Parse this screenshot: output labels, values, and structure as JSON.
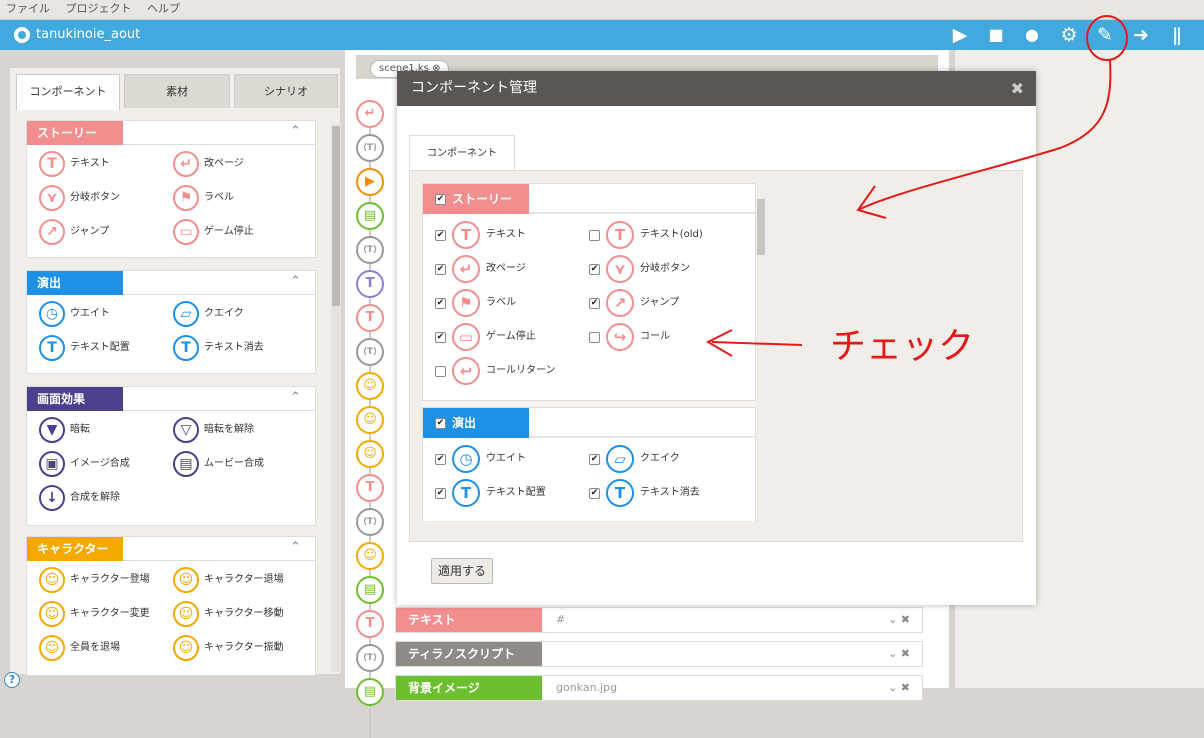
{
  "menu": [
    "ファイル",
    "プロジェクト",
    "ヘルプ"
  ],
  "app": {
    "title": "tanukinoie_aout"
  },
  "toolbar": {
    "play": "▶",
    "save": "■",
    "user": "●",
    "settings": "⚙",
    "tools": "✎",
    "export": "➜",
    "exit": "ǁ"
  },
  "left": {
    "tabs": [
      "コンポーネント",
      "素材",
      "シナリオ"
    ],
    "panels": [
      {
        "title": "ストーリー",
        "color": "#f28e8e",
        "items": [
          {
            "label": "テキスト",
            "glyph": "T"
          },
          {
            "label": "改ページ",
            "glyph": "↵"
          },
          {
            "label": "分岐ボタン",
            "glyph": "⋎"
          },
          {
            "label": "ラベル",
            "glyph": "⚑"
          },
          {
            "label": "ジャンプ",
            "glyph": "↗"
          },
          {
            "label": "ゲーム停止",
            "glyph": "▭"
          }
        ]
      },
      {
        "title": "演出",
        "color": "#1e90e6",
        "items": [
          {
            "label": "ウエイト",
            "glyph": "◷"
          },
          {
            "label": "クエイク",
            "glyph": "▱"
          },
          {
            "label": "テキスト配置",
            "glyph": "T"
          },
          {
            "label": "テキスト消去",
            "glyph": "T"
          }
        ]
      },
      {
        "title": "画面効果",
        "color": "#4c3f8c",
        "items": [
          {
            "label": "暗転",
            "glyph": "▼"
          },
          {
            "label": "暗転を解除",
            "glyph": "▽"
          },
          {
            "label": "イメージ合成",
            "glyph": "▣"
          },
          {
            "label": "ムービー合成",
            "glyph": "▤"
          },
          {
            "label": "合成を解除",
            "glyph": "↓"
          }
        ]
      },
      {
        "title": "キャラクター",
        "color": "#f5a800",
        "items": [
          {
            "label": "キャラクター登場",
            "glyph": "☺"
          },
          {
            "label": "キャラクター退場",
            "glyph": "☺"
          },
          {
            "label": "キャラクター変更",
            "glyph": "☺"
          },
          {
            "label": "キャラクター移動",
            "glyph": "☺"
          },
          {
            "label": "全員を退場",
            "glyph": "☺"
          },
          {
            "label": "キャラクター振動",
            "glyph": "☺"
          }
        ]
      }
    ]
  },
  "editor": {
    "scene_tab": "scene1.ks",
    "scene_tab_close": "⊗",
    "rows": [
      {
        "label": "テキスト",
        "value": "#",
        "color": "#f28e8e"
      },
      {
        "label": "ティラノスクリプト",
        "value": "",
        "color": "#8f8a85"
      },
      {
        "label": "背景イメージ",
        "value": "gonkan.jpg",
        "color": "#6cbf2f"
      }
    ],
    "row_controls": "⌄ ✖",
    "timeline": [
      {
        "glyph": "↵",
        "color": "#f28e8e"
      },
      {
        "glyph": "⟨T⟩",
        "color": "#999999"
      },
      {
        "glyph": "▶",
        "color": "#f28e00"
      },
      {
        "glyph": "▤",
        "color": "#6cbf2f"
      },
      {
        "glyph": "⟨T⟩",
        "color": "#999999"
      },
      {
        "glyph": "T",
        "color": "#8a7fd6"
      },
      {
        "glyph": "T",
        "color": "#f28e8e"
      },
      {
        "glyph": "⟨T⟩",
        "color": "#999999"
      },
      {
        "glyph": "☺",
        "color": "#f5a800"
      },
      {
        "glyph": "☺",
        "color": "#f5a800"
      },
      {
        "glyph": "☺",
        "color": "#f5a800"
      },
      {
        "glyph": "T",
        "color": "#f28e8e"
      },
      {
        "glyph": "⟨T⟩",
        "color": "#999999"
      },
      {
        "glyph": "☺",
        "color": "#f5a800"
      },
      {
        "glyph": "▤",
        "color": "#6cbf2f"
      },
      {
        "glyph": "T",
        "color": "#f28e8e"
      },
      {
        "glyph": "⟨T⟩",
        "color": "#999999"
      },
      {
        "glyph": "▤",
        "color": "#6cbf2f"
      }
    ]
  },
  "dialog": {
    "title": "コンポーネント管理",
    "close": "✖",
    "tab": "コンポーネント",
    "apply": "適用する",
    "groups": [
      {
        "title": "ストーリー",
        "checked": true,
        "color": "#f28e8e",
        "items": [
          {
            "label": "テキスト",
            "checked": true,
            "glyph": "T",
            "color": "#f28e8e"
          },
          {
            "label": "テキスト(old)",
            "checked": false,
            "glyph": "T",
            "color": "#f28e8e"
          },
          {
            "label": "改ページ",
            "checked": true,
            "glyph": "↵",
            "color": "#f28e8e"
          },
          {
            "label": "分岐ボタン",
            "checked": true,
            "glyph": "⋎",
            "color": "#f28e8e"
          },
          {
            "label": "ラベル",
            "checked": true,
            "glyph": "⚑",
            "color": "#f28e8e"
          },
          {
            "label": "ジャンプ",
            "checked": true,
            "glyph": "↗",
            "color": "#f28e8e"
          },
          {
            "label": "ゲーム停止",
            "checked": true,
            "glyph": "▭",
            "color": "#f28e8e"
          },
          {
            "label": "コール",
            "checked": false,
            "glyph": "↪",
            "color": "#f28e8e"
          },
          {
            "label": "コールリターン",
            "checked": false,
            "glyph": "↩",
            "color": "#f28e8e"
          }
        ]
      },
      {
        "title": "演出",
        "checked": true,
        "color": "#1e90e6",
        "items": [
          {
            "label": "ウエイト",
            "checked": true,
            "glyph": "◷",
            "color": "#1e90e6"
          },
          {
            "label": "クエイク",
            "checked": true,
            "glyph": "▱",
            "color": "#1e90e6"
          },
          {
            "label": "テキスト配置",
            "checked": true,
            "glyph": "T",
            "color": "#1e90e6"
          },
          {
            "label": "テキスト消去",
            "checked": true,
            "glyph": "T",
            "color": "#1e90e6"
          }
        ]
      }
    ]
  },
  "annotations": {
    "check_label": "チェック",
    "color": "#e21a1a"
  },
  "help": "?"
}
